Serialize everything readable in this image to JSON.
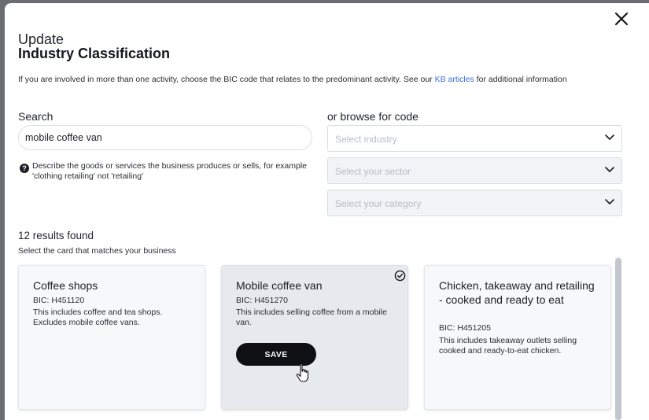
{
  "modal": {
    "title_light": "Update",
    "title_bold": "Industry Classification",
    "intro_text": "If you are involved in more than one activity, choose the BIC code that relates to the predominant activity. See our",
    "intro_link": "KB articles",
    "intro_text_after": "for additional information"
  },
  "search": {
    "label": "Search",
    "value": "mobile coffee van",
    "hint": "Describe the goods or services the business produces or sells, for example 'clothing retailing' not 'retailing'",
    "hint_icon": "question-circle-icon"
  },
  "browse": {
    "label": "or browse for code",
    "selects": [
      {
        "placeholder": "Select industry",
        "enabled": true
      },
      {
        "placeholder": "Select your sector",
        "enabled": false
      },
      {
        "placeholder": "Select your category",
        "enabled": false
      }
    ]
  },
  "results": {
    "count_text": "12 results found",
    "instruction": "Select the card that matches your business",
    "cards": [
      {
        "title": "Coffee shops",
        "bic": "BIC: H451120",
        "description": "This includes coffee and tea shops. Excludes mobile coffee vans.",
        "selected": false
      },
      {
        "title": "Mobile coffee van",
        "bic": "BIC: H451270",
        "description": "This includes selling coffee from a mobile van.",
        "selected": true,
        "save_label": "SAVE"
      },
      {
        "title": "Chicken, takeaway and retailing - cooked and ready to eat",
        "bic": "BIC: H451205",
        "description": "This includes takeaway outlets selling cooked and ready-to-eat chicken.",
        "selected": false
      }
    ]
  },
  "colors": {
    "accent_link": "#3b6fd1",
    "save_button": "#0f1013",
    "selected_card": "#e6e9ee",
    "card_bg": "#f7f8fa",
    "overlay": "#6b6d70"
  },
  "icons": {
    "close": "close-icon",
    "chevron": "chevron-down-icon",
    "check": "check-circle-icon",
    "cursor": "hand-cursor-icon"
  }
}
